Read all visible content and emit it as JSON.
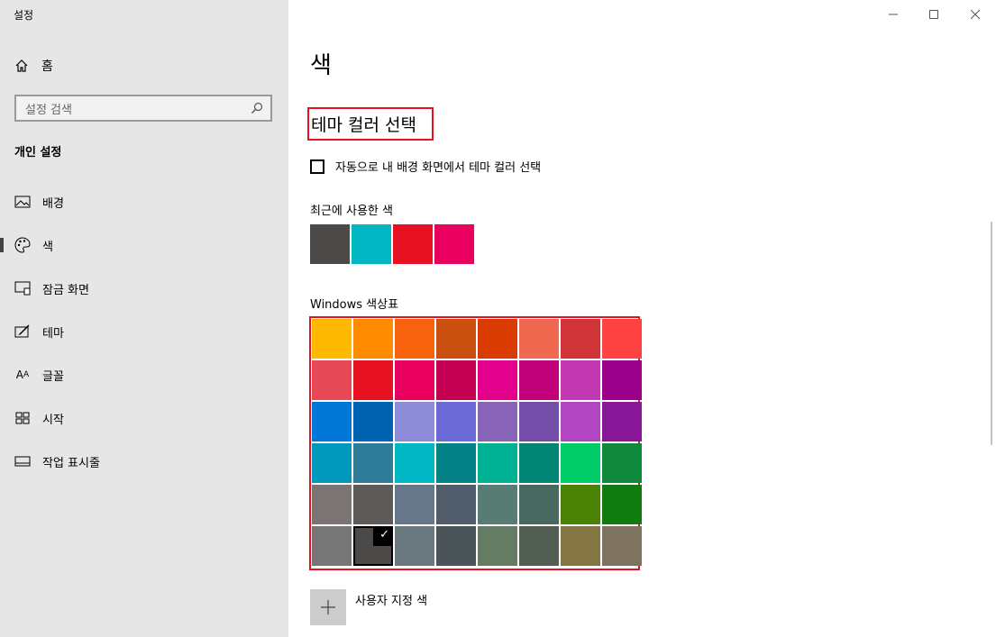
{
  "window": {
    "title": "설정"
  },
  "sidebar": {
    "home_label": "홈",
    "search_placeholder": "설정 검색",
    "section_title": "개인 설정",
    "items": [
      {
        "label": "배경",
        "icon": "picture-icon"
      },
      {
        "label": "색",
        "icon": "palette-icon",
        "active": true
      },
      {
        "label": "잠금 화면",
        "icon": "lock-screen-icon"
      },
      {
        "label": "테마",
        "icon": "theme-brush-icon"
      },
      {
        "label": "글꼴",
        "icon": "font-icon"
      },
      {
        "label": "시작",
        "icon": "start-icon"
      },
      {
        "label": "작업 표시줄",
        "icon": "taskbar-icon"
      }
    ]
  },
  "main": {
    "page_title": "색",
    "subheading": "테마 컬러 선택",
    "auto_checkbox_label": "자동으로 내 배경 화면에서 테마 컬러 선택",
    "auto_checkbox_checked": false,
    "recent_label": "최근에 사용한 색",
    "recent_colors": [
      "#4c4a48",
      "#00b7c3",
      "#e81123",
      "#ea005e"
    ],
    "palette_label": "Windows 색상표",
    "palette_colors": [
      "#ffb900",
      "#ff8c00",
      "#f7630c",
      "#ca5010",
      "#da3b01",
      "#ef6950",
      "#d13438",
      "#ff4343",
      "#e74856",
      "#e81123",
      "#ea005e",
      "#c30052",
      "#e3008c",
      "#bf0077",
      "#c239b3",
      "#9a0089",
      "#0078d7",
      "#0063b1",
      "#8e8cd8",
      "#6b69d6",
      "#8764b8",
      "#744da9",
      "#b146c2",
      "#881798",
      "#0099bc",
      "#2d7d9a",
      "#00b7c3",
      "#038387",
      "#00b294",
      "#018574",
      "#00cc6a",
      "#10893e",
      "#7a7574",
      "#5d5a58",
      "#68768a",
      "#515c6b",
      "#567c73",
      "#486860",
      "#498205",
      "#107c10",
      "#767676",
      "#4c4a48",
      "#69797e",
      "#4a5459",
      "#647c64",
      "#525e54",
      "#847545",
      "#7e735f"
    ],
    "selected_palette_index": 41,
    "custom_color_label": "사용자 지정 색"
  }
}
